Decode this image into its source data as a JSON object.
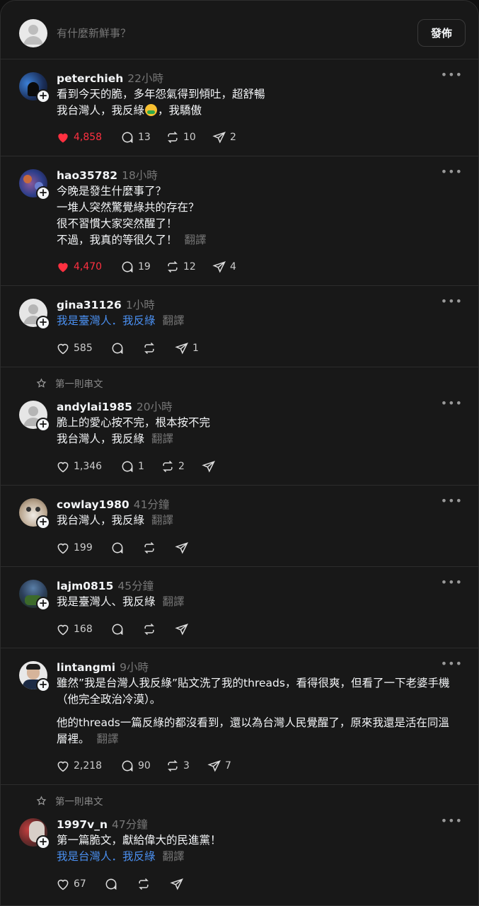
{
  "composer": {
    "prompt": "有什麼新鮮事？",
    "post_label": "發佈"
  },
  "pinned_label": "第一則串文",
  "translate_label": "翻譯",
  "posts": [
    {
      "username": "peterchieh",
      "time": "22小時",
      "lines": [
        "看到今天的脆，多年怨氣得到傾吐，超舒暢",
        "我台灣人，我反綠",
        "，我驕傲"
      ],
      "likes": "4,858",
      "comments": "13",
      "reposts": "10",
      "shares": "2",
      "liked": true
    },
    {
      "username": "hao35782",
      "time": "18小時",
      "lines": [
        "今晚是發生什麼事了？",
        "一堆人突然驚覺綠共的存在？",
        "很不習慣大家突然醒了！",
        "不過，我真的等很久了！"
      ],
      "likes": "4,470",
      "comments": "19",
      "reposts": "12",
      "shares": "4",
      "liked": true
    },
    {
      "username": "gina31126",
      "time": "1小時",
      "lines": [
        "我是臺灣人．我反綠"
      ],
      "likes": "585",
      "comments": "",
      "reposts": "",
      "shares": "1",
      "liked": false
    },
    {
      "username": "andylai1985",
      "time": "20小時",
      "lines": [
        "脆上的愛心按不完，根本按不完",
        "我台灣人，我反綠"
      ],
      "likes": "1,346",
      "comments": "1",
      "reposts": "2",
      "shares": "",
      "liked": false
    },
    {
      "username": "cowlay1980",
      "time": "41分鐘",
      "lines": [
        "我台灣人，我反綠"
      ],
      "likes": "199",
      "comments": "",
      "reposts": "",
      "shares": "",
      "liked": false
    },
    {
      "username": "lajm0815",
      "time": "45分鐘",
      "lines": [
        "我是臺灣人、我反綠"
      ],
      "likes": "168",
      "comments": "",
      "reposts": "",
      "shares": "",
      "liked": false
    },
    {
      "username": "lintangmi",
      "time": "9小時",
      "lines": [
        "雖然”我是台灣人我反綠”貼文洗了我的threads，看得很爽，但看了一下老婆手機（他完全政治冷漠）。",
        "他的threads一篇反綠的都沒看到，還以為台灣人民覺醒了，原來我還是活在同溫層裡。"
      ],
      "likes": "2,218",
      "comments": "90",
      "reposts": "3",
      "shares": "7",
      "liked": false
    },
    {
      "username": "1997v_n",
      "time": "47分鐘",
      "lines": [
        "第一篇脆文，獻給偉大的民進黨！",
        "我是台灣人．我反綠"
      ],
      "likes": "67",
      "comments": "",
      "reposts": "",
      "shares": "",
      "liked": false
    }
  ],
  "colors": {
    "background": "#181818",
    "like": "#ff3040",
    "link": "#4a8ff0"
  }
}
